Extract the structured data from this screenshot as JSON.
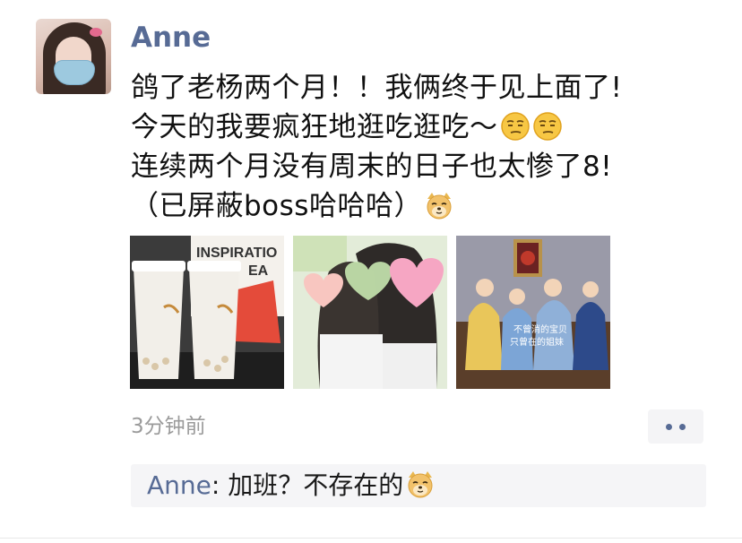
{
  "post": {
    "author": "Anne",
    "lines": [
      "鸽了老杨两个月！！我俩终于见上面了!",
      "今天的我要疯狂地逛吃逛吃～",
      "连续两个月没有周末的日子也太惨了8!",
      "（已屏蔽boss哈哈哈）"
    ],
    "line_emojis": [
      [],
      [
        "smirk-emoji",
        "smirk-emoji"
      ],
      [],
      [
        "doge-emoji"
      ]
    ],
    "photos": [
      {
        "name": "bubble-tea-photo",
        "sign_text": [
          "INSPIRATIO",
          "EA"
        ]
      },
      {
        "name": "friends-selfie-photo"
      },
      {
        "name": "cartoon-meme-photo",
        "caption": [
          "不曾消的宝贝",
          "只曾在的姐妹"
        ]
      }
    ],
    "timestamp": "3分钟前"
  },
  "more": {
    "icon": "more-dots-icon"
  },
  "comments": [
    {
      "author": "Anne",
      "separator": ": ",
      "text": "加班？不存在的",
      "emoji": "doge-emoji"
    }
  ],
  "colors": {
    "link": "#576b95",
    "text": "#111111",
    "muted": "#9b9b9b",
    "comment_bg": "#f5f5f7"
  }
}
